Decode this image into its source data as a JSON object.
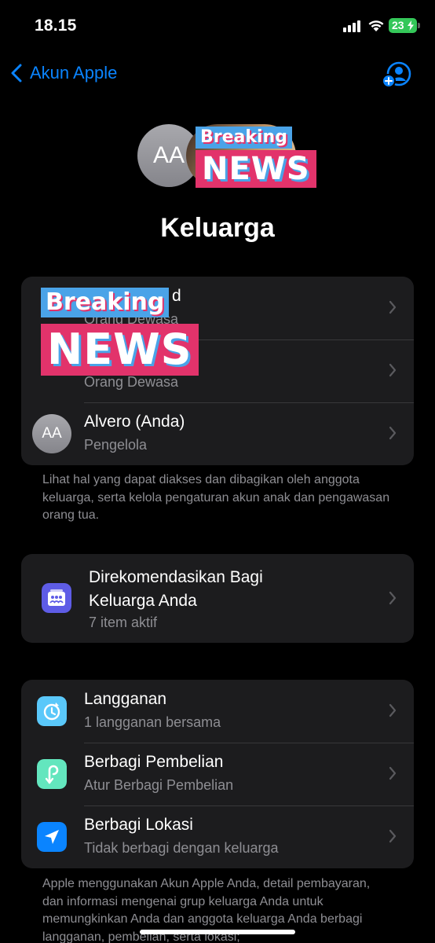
{
  "status_bar": {
    "time": "18.15",
    "battery": "23"
  },
  "nav": {
    "back_label": "Akun Apple"
  },
  "header": {
    "avatar_initials": "AA",
    "title": "Keluarga"
  },
  "sticker": {
    "line1": "Breaking",
    "line2": "NEWS"
  },
  "members": [
    {
      "name": "d",
      "role": "Orang Dewasa"
    },
    {
      "name": "",
      "role": "Orang Dewasa"
    },
    {
      "name": "Alvero (Anda)",
      "role": "Pengelola",
      "initials": "AA"
    }
  ],
  "members_footnote": "Lihat hal yang dapat diakses dan dibagikan oleh anggota keluarga, serta kelola pengaturan akun anak dan pengawasan orang tua.",
  "recommended": {
    "title_line1": "Direkomendasikan Bagi",
    "title_line2": "Keluarga Anda",
    "subtitle": "7 item aktif"
  },
  "features": [
    {
      "title": "Langganan",
      "subtitle": "1 langganan bersama",
      "icon": "subscription-icon",
      "color": "#5ac8fa"
    },
    {
      "title": "Berbagi Pembelian",
      "subtitle": "Atur Berbagi Pembelian",
      "icon": "purchase-sharing-icon",
      "color": "#63e6be"
    },
    {
      "title": "Berbagi Lokasi",
      "subtitle": "Tidak berbagi dengan keluarga",
      "icon": "location-arrow-icon",
      "color": "#0a84ff"
    }
  ],
  "bottom_footnote": "Apple menggunakan Akun Apple Anda, detail pembayaran, dan informasi mengenai grup keluarga Anda untuk memungkinkan Anda dan anggota keluarga Anda berbagi langganan, pembelian, serta lokasi;"
}
